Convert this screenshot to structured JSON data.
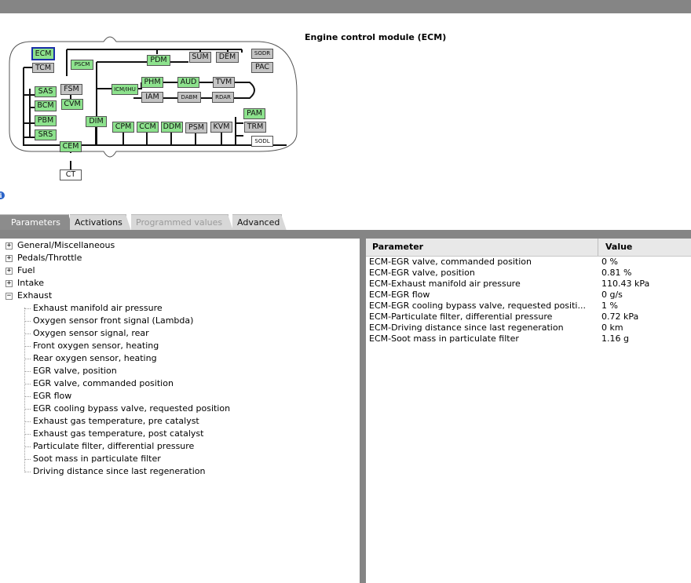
{
  "module_title": "Engine control module (ECM)",
  "diagram": {
    "nodes": [
      {
        "id": "ECM",
        "label": "ECM",
        "color": "green",
        "selected": true
      },
      {
        "id": "TCM",
        "label": "TCM",
        "color": "gray"
      },
      {
        "id": "PSCM",
        "label": "PSCM",
        "color": "green"
      },
      {
        "id": "PDM",
        "label": "PDM",
        "color": "green"
      },
      {
        "id": "SUM",
        "label": "SUM",
        "color": "gray"
      },
      {
        "id": "DEM",
        "label": "DEM",
        "color": "gray"
      },
      {
        "id": "SODR",
        "label": "SODR",
        "color": "gray"
      },
      {
        "id": "PAC",
        "label": "PAC",
        "color": "gray"
      },
      {
        "id": "ICM",
        "label": "ICM/IHU",
        "color": "green"
      },
      {
        "id": "PHM",
        "label": "PHM",
        "color": "green"
      },
      {
        "id": "AUD",
        "label": "AUD",
        "color": "green"
      },
      {
        "id": "TVM",
        "label": "TVM",
        "color": "gray"
      },
      {
        "id": "SAS",
        "label": "SAS",
        "color": "green"
      },
      {
        "id": "FSM",
        "label": "FSM",
        "color": "gray"
      },
      {
        "id": "IAM",
        "label": "IAM",
        "color": "gray"
      },
      {
        "id": "DABM",
        "label": "DABM",
        "color": "gray"
      },
      {
        "id": "RDAR",
        "label": "RDAR",
        "color": "gray"
      },
      {
        "id": "BCM",
        "label": "BCM",
        "color": "green"
      },
      {
        "id": "CVM",
        "label": "CVM",
        "color": "green"
      },
      {
        "id": "PAM",
        "label": "PAM",
        "color": "green"
      },
      {
        "id": "PBM",
        "label": "PBM",
        "color": "green"
      },
      {
        "id": "DIM",
        "label": "DIM",
        "color": "green"
      },
      {
        "id": "CPM",
        "label": "CPM",
        "color": "green"
      },
      {
        "id": "CCM",
        "label": "CCM",
        "color": "green"
      },
      {
        "id": "DDM",
        "label": "DDM",
        "color": "green"
      },
      {
        "id": "PSM",
        "label": "PSM",
        "color": "gray"
      },
      {
        "id": "KVM",
        "label": "KVM",
        "color": "gray"
      },
      {
        "id": "TRM",
        "label": "TRM",
        "color": "gray"
      },
      {
        "id": "SRS",
        "label": "SRS",
        "color": "green"
      },
      {
        "id": "SODL",
        "label": "SODL",
        "color": "white"
      },
      {
        "id": "CEM",
        "label": "CEM",
        "color": "green"
      },
      {
        "id": "CT",
        "label": "CT",
        "color": "white"
      }
    ]
  },
  "tabs": [
    {
      "label": "Parameters",
      "state": "active"
    },
    {
      "label": "Activations",
      "state": "normal"
    },
    {
      "label": "Programmed values",
      "state": "disabled"
    },
    {
      "label": "Advanced",
      "state": "normal"
    }
  ],
  "tree": {
    "groups": [
      {
        "label": "General/Miscellaneous",
        "expanded": false
      },
      {
        "label": "Pedals/Throttle",
        "expanded": false
      },
      {
        "label": "Fuel",
        "expanded": false
      },
      {
        "label": "Intake",
        "expanded": false
      },
      {
        "label": "Exhaust",
        "expanded": true
      }
    ],
    "exhaust_items": [
      "Exhaust manifold air pressure",
      "Oxygen sensor front signal (Lambda)",
      "Oxygen sensor signal, rear",
      "Front oxygen sensor, heating",
      "Rear oxygen sensor, heating",
      "EGR valve, position",
      "EGR valve, commanded position",
      "EGR flow",
      "EGR cooling bypass valve, requested position",
      "Exhaust gas temperature, pre catalyst",
      "Exhaust gas temperature, post catalyst",
      "Particulate filter, differential pressure",
      "Soot mass in particulate filter",
      "Driving distance since last regeneration"
    ]
  },
  "table": {
    "columns": [
      "Parameter",
      "Value"
    ],
    "rows": [
      {
        "parameter": "ECM-EGR valve, commanded position",
        "value": "0 %"
      },
      {
        "parameter": "ECM-EGR valve, position",
        "value": "0.81 %"
      },
      {
        "parameter": "ECM-Exhaust manifold air pressure",
        "value": "110.43 kPa"
      },
      {
        "parameter": "ECM-EGR flow",
        "value": "0 g/s"
      },
      {
        "parameter": "ECM-EGR cooling bypass valve, requested positi...",
        "value": "1 %"
      },
      {
        "parameter": "ECM-Particulate filter, differential pressure",
        "value": "0.72 kPa"
      },
      {
        "parameter": "ECM-Driving distance since last regeneration",
        "value": "0 km"
      },
      {
        "parameter": "ECM-Soot mass in particulate filter",
        "value": "1.16 g"
      }
    ]
  }
}
